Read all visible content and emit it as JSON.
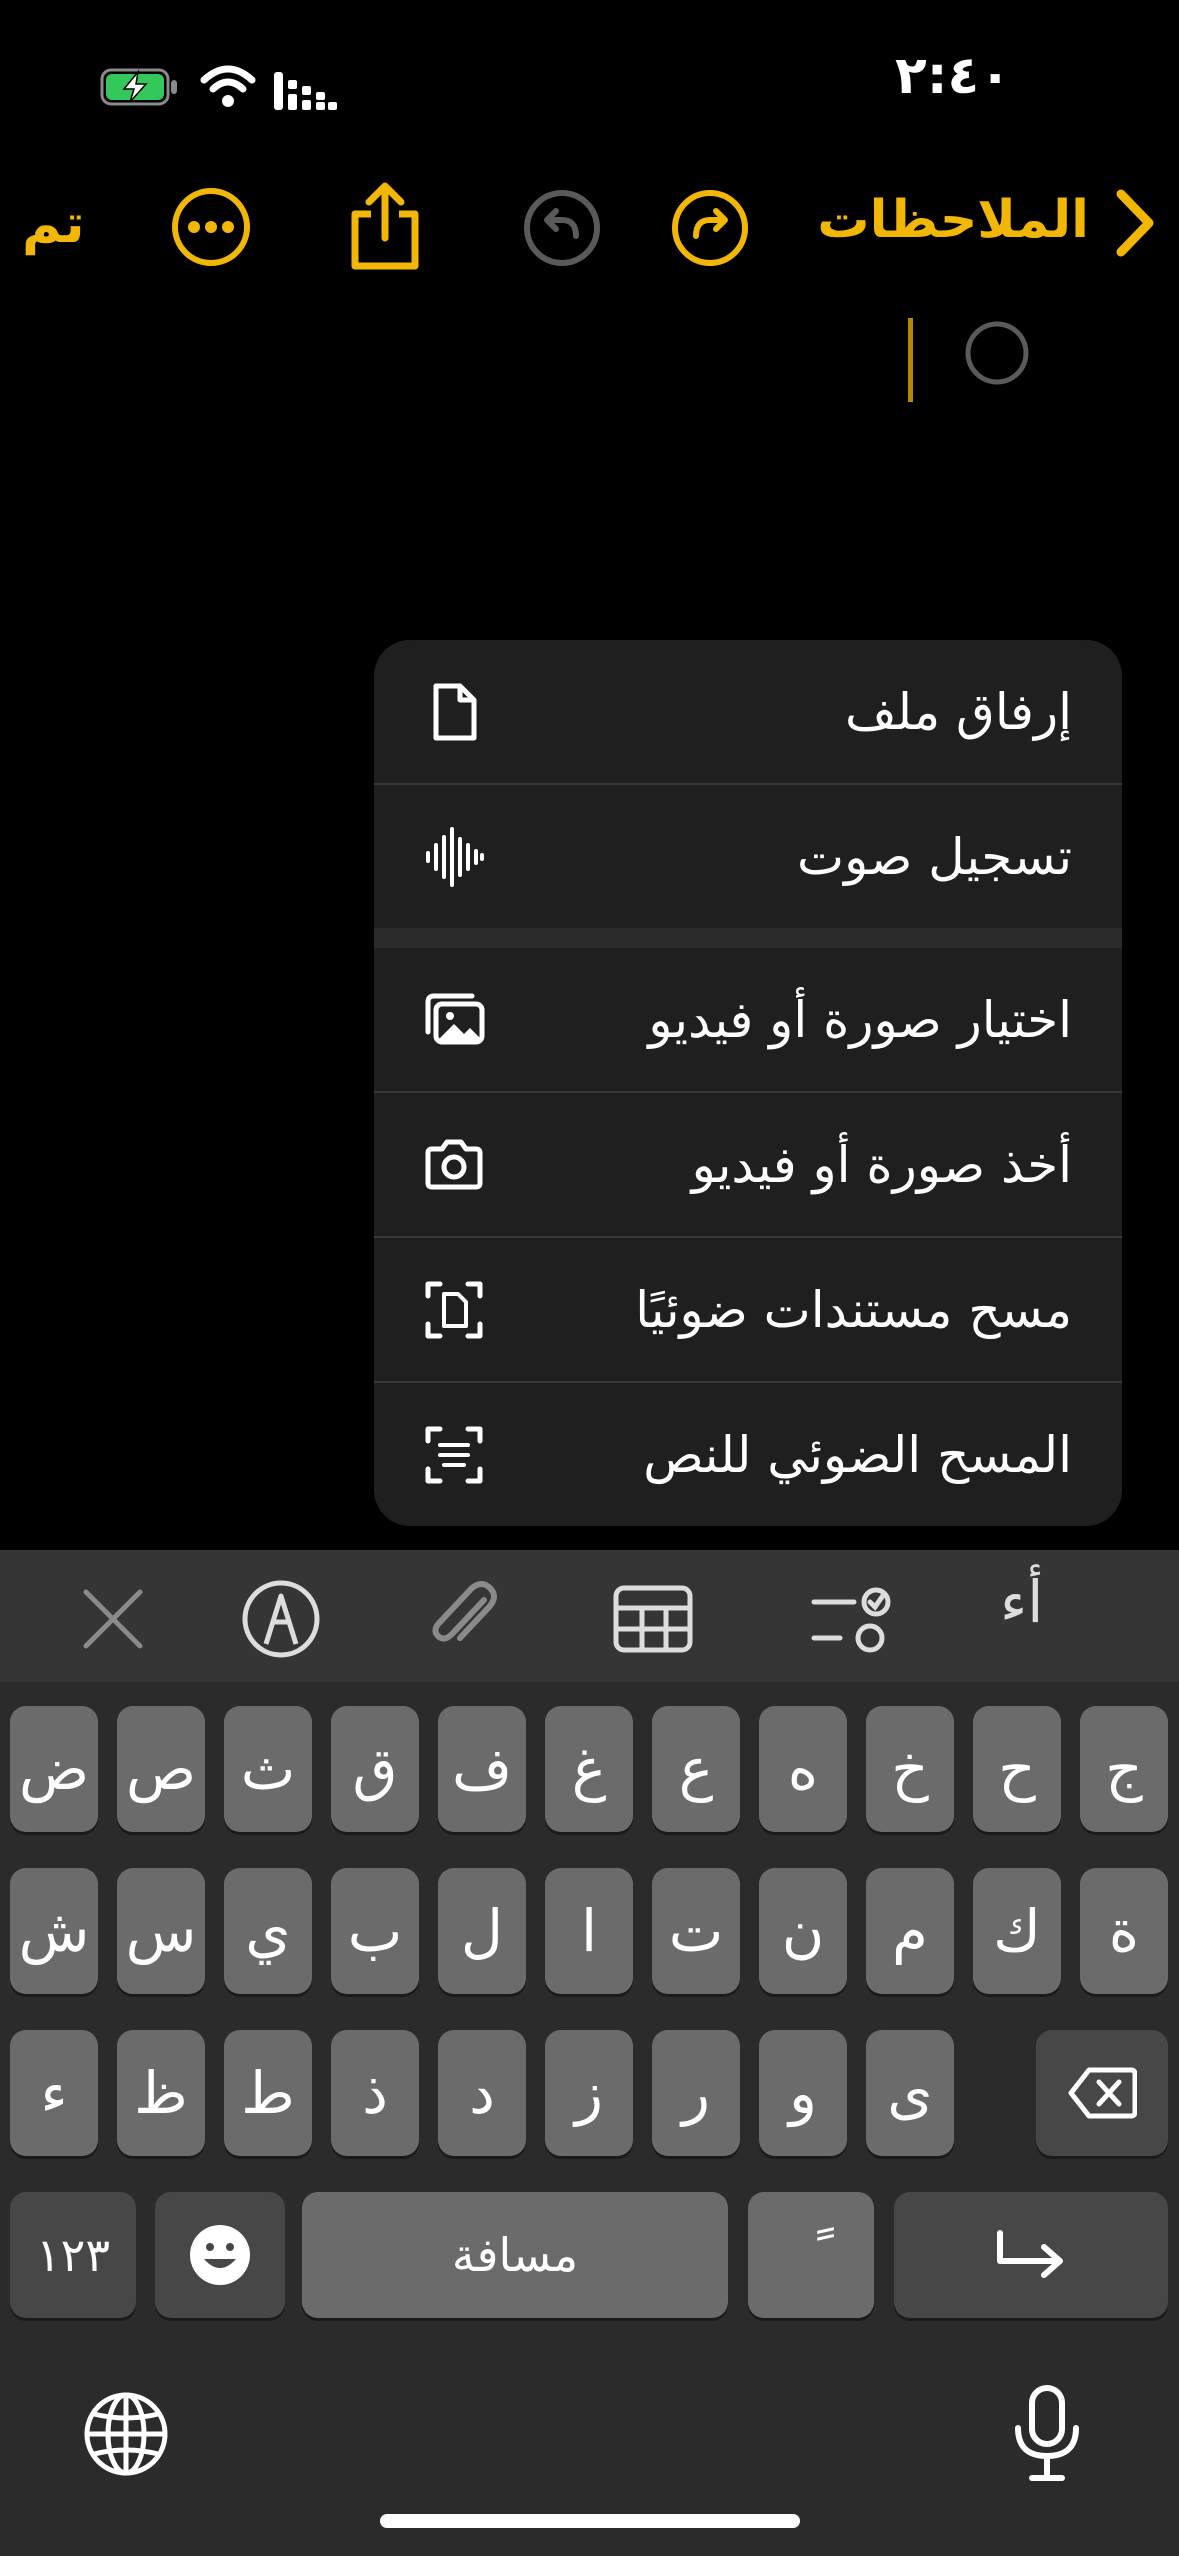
{
  "status": {
    "time": "٢:٤٠"
  },
  "nav": {
    "back_label": "الملاحظات",
    "done_label": "تم"
  },
  "menu": {
    "items": [
      {
        "label": "إرفاق ملف",
        "icon": "document-icon"
      },
      {
        "label": "تسجيل صوت",
        "icon": "waveform-icon"
      },
      {
        "label": "اختيار صورة أو فيديو",
        "icon": "photo-library-icon"
      },
      {
        "label": "أخذ صورة أو فيديو",
        "icon": "camera-icon"
      },
      {
        "label": "مسح مستندات ضوئيًا",
        "icon": "doc-scan-icon"
      },
      {
        "label": "المسح الضوئي للنص",
        "icon": "text-scan-icon"
      }
    ]
  },
  "toolbar": {
    "format_label": "أء",
    "icons": [
      "checklist-icon",
      "table-icon",
      "attachment-icon",
      "markup-icon",
      "close-icon"
    ]
  },
  "keyboard": {
    "row1": [
      "ج",
      "ح",
      "خ",
      "ه",
      "ع",
      "غ",
      "ف",
      "ق",
      "ث",
      "ص",
      "ض"
    ],
    "row2": [
      "ة",
      "ك",
      "م",
      "ن",
      "ت",
      "ا",
      "ل",
      "ب",
      "ي",
      "س",
      "ش"
    ],
    "row3": [
      "ى",
      "و",
      "ر",
      "ز",
      "د",
      "ذ",
      "ط",
      "ظ",
      "ء"
    ],
    "numbers_label": "١٢٣",
    "space_label": "مسافة",
    "diacritic_label": "ً"
  }
}
